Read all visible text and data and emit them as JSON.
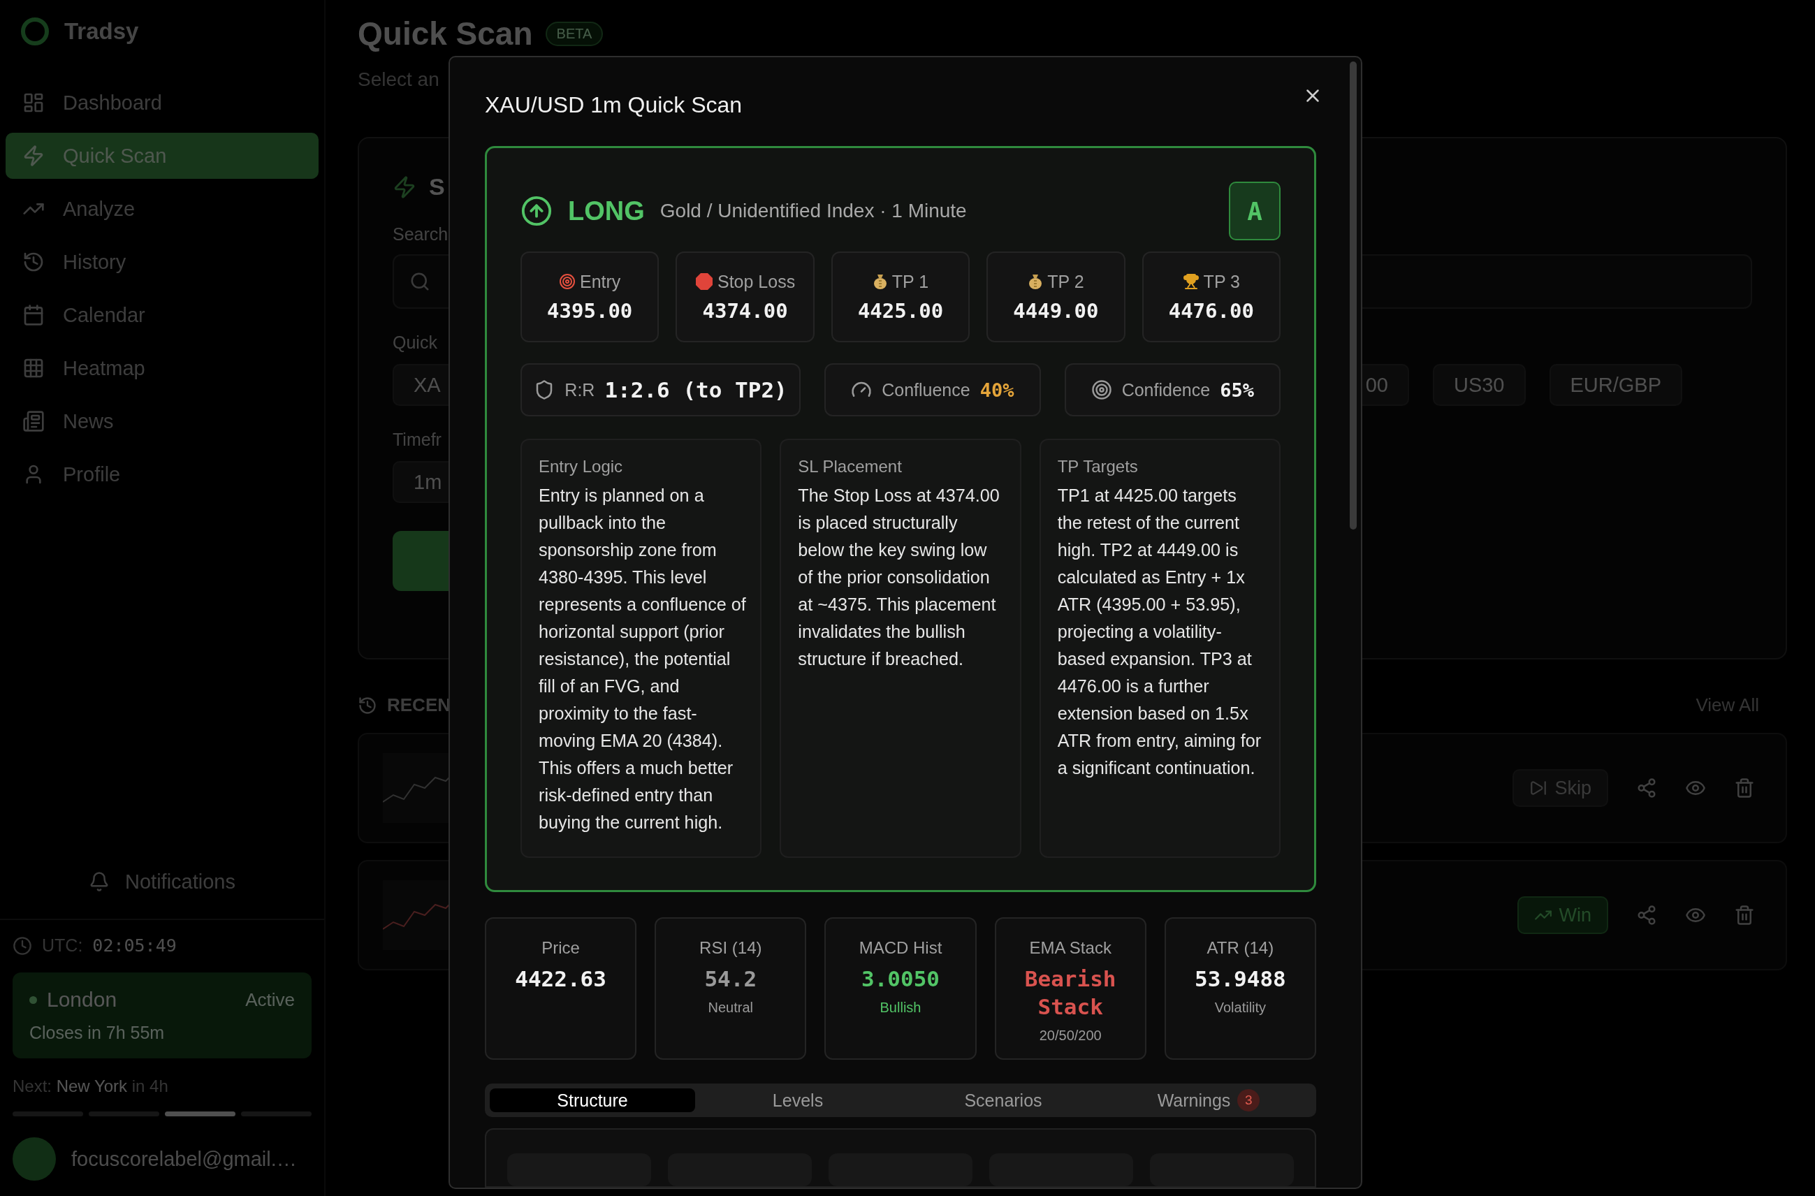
{
  "sidebar": {
    "brand": "Tradsy",
    "items": [
      {
        "label": "Dashboard",
        "selected": false
      },
      {
        "label": "Quick Scan",
        "selected": true
      },
      {
        "label": "Analyze",
        "selected": false
      },
      {
        "label": "History",
        "selected": false
      },
      {
        "label": "Calendar",
        "selected": false
      },
      {
        "label": "Heatmap",
        "selected": false
      },
      {
        "label": "News",
        "selected": false
      },
      {
        "label": "Profile",
        "selected": false
      }
    ],
    "notifications": "Notifications",
    "clock": {
      "label": "UTC:",
      "time": "02:05:49"
    },
    "session": {
      "name": "London",
      "status": "Active",
      "detail": "Closes in 7h 55m"
    },
    "next_session": {
      "prefix": "Next:",
      "name": "New York",
      "suffix": "in 4h"
    },
    "session_bars": [
      {
        "selected": false
      },
      {
        "selected": false
      },
      {
        "selected": true
      },
      {
        "selected": false
      }
    ],
    "user": {
      "email": "focuscorelabel@gmail.…"
    }
  },
  "page": {
    "title": "Quick Scan",
    "badge": "BETA",
    "subtitle": "Select an",
    "card": {
      "title": "S",
      "search_label": "Search",
      "quick_label": "Quick",
      "chips": [
        {
          "label": "XA"
        },
        {
          "label": "00"
        },
        {
          "label": "US30"
        },
        {
          "label": "EUR/GBP"
        }
      ],
      "timeframe_label": "Timefr",
      "timeframe": "1m"
    },
    "recent": {
      "title": "RECEN",
      "link": "View All",
      "rows": [
        {
          "kind": "skip",
          "action": "Skip"
        },
        {
          "kind": "win",
          "action": "Win"
        }
      ]
    }
  },
  "modal": {
    "title": "XAU/USD 1m Quick Scan",
    "signal": {
      "direction": "LONG",
      "subtitle": "Gold / Unidentified Index · 1 Minute",
      "grade": "A",
      "levels": [
        {
          "label": "Entry",
          "value": "4395.00"
        },
        {
          "label": "Stop Loss",
          "value": "4374.00"
        },
        {
          "label": "TP 1",
          "value": "4425.00"
        },
        {
          "label": "TP 2",
          "value": "4449.00"
        },
        {
          "label": "TP 3",
          "value": "4476.00"
        }
      ],
      "metrics": [
        {
          "label": "R:R",
          "value": "1:2.6 (to TP2)",
          "kind": "large"
        },
        {
          "label": "Confluence",
          "value": "40%",
          "kind": "warn"
        },
        {
          "label": "Confidence",
          "value": "65%",
          "kind": "plain"
        }
      ],
      "notes": [
        {
          "heading": "Entry Logic",
          "body": "Entry is planned on a pullback into the sponsorship zone from 4380-4395. This level represents a confluence of horizontal support (prior resistance), the potential fill of an FVG, and proximity to the fast-moving EMA 20 (4384). This offers a much better risk-defined entry than buying the current high."
        },
        {
          "heading": "SL Placement",
          "body": "The Stop Loss at 4374.00 is placed structurally below the key swing low of the prior consolidation at ~4375. This placement invalidates the bullish structure if breached."
        },
        {
          "heading": "TP Targets",
          "body": "TP1 at 4425.00 targets the retest of the current high. TP2 at 4449.00 is calculated as Entry + 1x ATR (4395.00 + 53.95), projecting a volatility-based expansion. TP3 at 4476.00 is a further extension based on 1.5x ATR from entry, aiming for a significant continuation."
        }
      ]
    },
    "indicators": [
      {
        "label": "Price",
        "value": "4422.63",
        "kind": "plain"
      },
      {
        "label": "RSI (14)",
        "value": "54.2",
        "note": "Neutral",
        "kind": "neutral"
      },
      {
        "label": "MACD Hist",
        "value": "3.0050",
        "note": "Bullish",
        "kind": "bull"
      },
      {
        "label": "EMA Stack",
        "value": "Bearish Stack",
        "note": "20/50/200",
        "kind": "bear"
      },
      {
        "label": "ATR (14)",
        "value": "53.9488",
        "note": "Volatility",
        "kind": "plain"
      }
    ],
    "tabs": [
      {
        "label": "Structure",
        "selected": true
      },
      {
        "label": "Levels",
        "selected": false
      },
      {
        "label": "Scenarios",
        "selected": false
      },
      {
        "label": "Warnings",
        "selected": false,
        "badge": "3"
      }
    ]
  }
}
